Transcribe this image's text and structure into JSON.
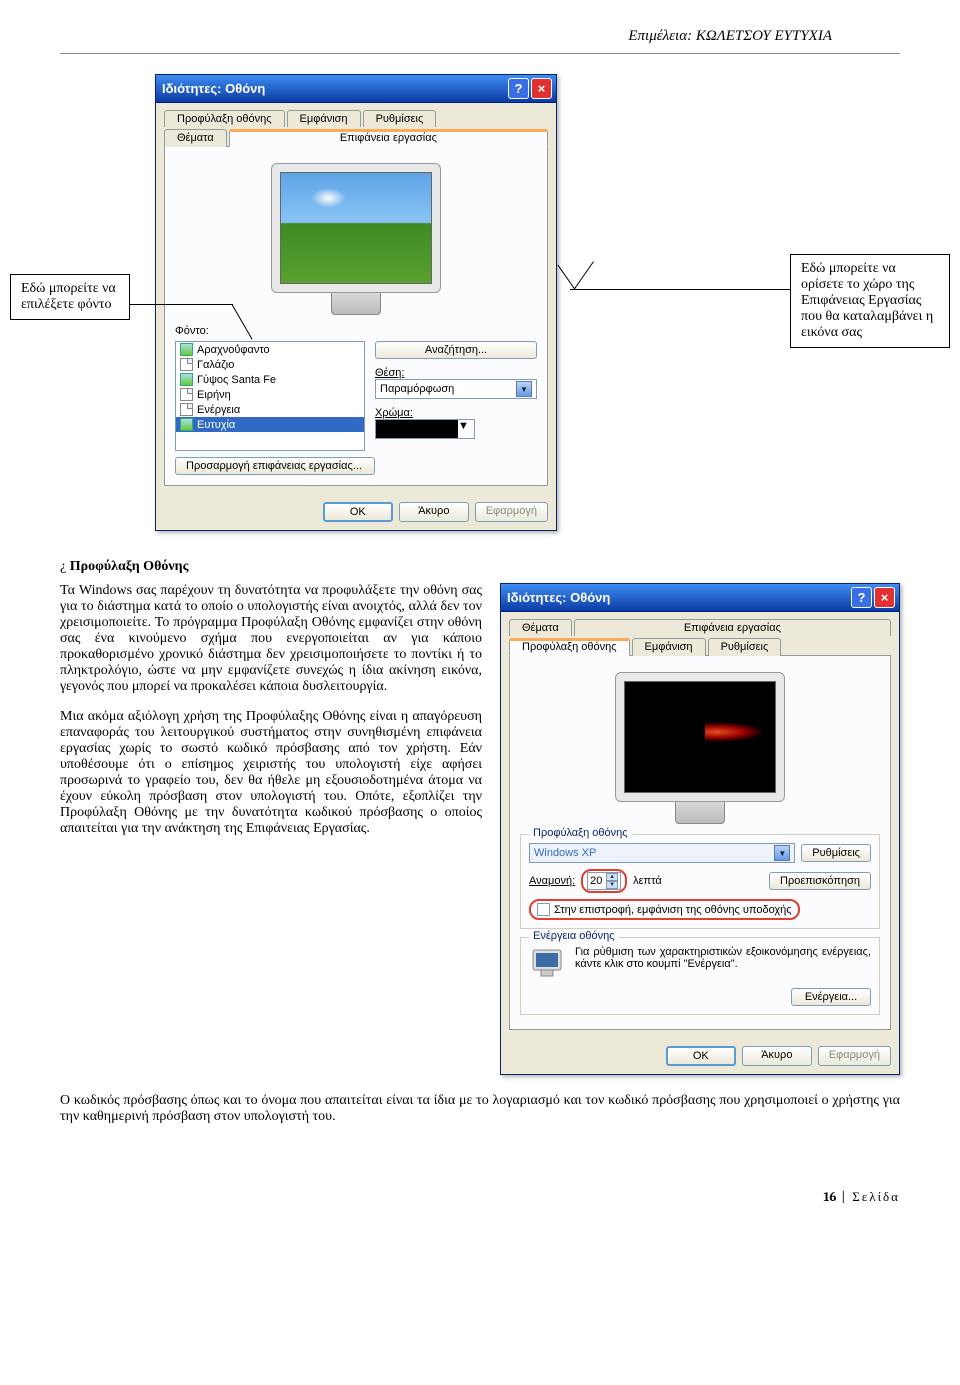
{
  "header": {
    "text": "Επιμέλεια: ΚΩΛΕΤΣΟΥ ΕΥΤΥΧΙΑ"
  },
  "callouts": {
    "left": "Εδώ μπορείτε να επιλέξετε φόντο",
    "right": "Εδώ μπορείτε να ορίσετε το χώρο της Επιφάνειας Εργασίας που θα καταλαμβάνει η εικόνα σας"
  },
  "dialog1": {
    "title": "Ιδιότητες: Οθόνη",
    "tabs": {
      "row1": [
        "Προφύλαξη οθόνης",
        "Εμφάνιση",
        "Ρυθμίσεις"
      ],
      "row2": [
        "Θέματα",
        "Επιφάνεια εργασίας"
      ]
    },
    "bg_label": "Φόντο:",
    "items": [
      "Αραχνοΰφαντο",
      "Γαλάζιο",
      "Γύψος Santa Fe",
      "Ειρήνη",
      "Ενέργεια",
      "Ευτυχία"
    ],
    "selected_index": 5,
    "browse_btn": "Αναζήτηση...",
    "position_label": "Θέση:",
    "position_value": "Παραμόρφωση",
    "color_label": "Χρώμα:",
    "customize_btn": "Προσαρμογή επιφάνειας εργασίας...",
    "ok": "OK",
    "cancel": "Άκυρο",
    "apply": "Εφαρμογή"
  },
  "section": {
    "bullet": "¿",
    "title": "Προφύλαξη Οθόνης",
    "para1": "Τα Windows σας παρέχουν τη δυνατότητα να προφυλάξετε την οθόνη σας για το διάστημα κατά το οποίο ο υπολογιστής είναι ανοιχτός, αλλά δεν τον χρεισιμοποιείτε. Το πρόγραμμα Προφύλαξη Οθόνης εμφανίζει στην οθόνη σας ένα κινούμενο σχήμα που ενεργοποιείται αν για κάποιο προκαθορισμένο χρονικό διάστημα δεν χρεισιμοποιήσετε το ποντίκι ή το πληκτρολόγιο, ώστε να μην εμφανίζετε συνεχώς η ίδια ακίνηση εικόνα, γεγονός που μπορεί να προκαλέσει κάποια δυσλειτουργία.",
    "para2": "Μια ακόμα αξιόλογη χρήση της Προφύλαξης Οθόνης είναι η απαγόρευση επαναφοράς του λειτουργικού συστήματος στην συνηθισμένη επιφάνεια εργασίας χωρίς το σωστό κωδικό πρόσβασης από τον χρήστη. Εάν υποθέσουμε ότι ο επίσημος χειριστής του υπολογιστή είχε αφήσει προσωρινά το γραφείο του, δεν θα ήθελε μη εξουσιοδοτημένα άτομα να έχουν εύκολη πρόσβαση στον υπολογιστή του. Οπότε, εξοπλίζει την Προφύλαξη Οθόνης με την δυνατότητα κωδικού πρόσβασης ο οποίος απαιτείται για την ανάκτηση της Επιφάνειας Εργασίας.",
    "para3": "Ο κωδικός πρόσβασης όπως και το όνομα που απαιτείται είναι τα ίδια με το λογαριασμό και τον κωδικό πρόσβασης που χρησιμοποιεί ο χρήστης για την καθημερινή πρόσβαση στον υπολογιστή του."
  },
  "dialog2": {
    "title": "Ιδιότητες: Οθόνη",
    "tabs": {
      "row1": [
        "Θέματα",
        "Επιφάνεια εργασίας"
      ],
      "row2": [
        "Προφύλαξη οθόνης",
        "Εμφάνιση",
        "Ρυθμίσεις"
      ]
    },
    "saver_group": "Προφύλαξη οθόνης",
    "saver_value": "Windows XP",
    "settings_btn": "Ρυθμίσεις",
    "wait_label": "Αναμονή:",
    "wait_value": "20",
    "wait_unit": "λεπτά",
    "preview_btn": "Προεπισκόπηση",
    "resume_cb": "Στην επιστροφή, εμφάνιση της οθόνης υποδοχής",
    "energy_group": "Ενέργεια οθόνης",
    "energy_text": "Για ρύθμιση των χαρακτηριστικών εξοικονόμησης ενέργειας, κάντε κλικ στο κουμπί \"Ενέργεια\".",
    "energy_btn": "Ενέργεια...",
    "ok": "OK",
    "cancel": "Άκυρο",
    "apply": "Εφαρμογή"
  },
  "footer": {
    "page_num": "16",
    "label": "Σελίδα"
  }
}
